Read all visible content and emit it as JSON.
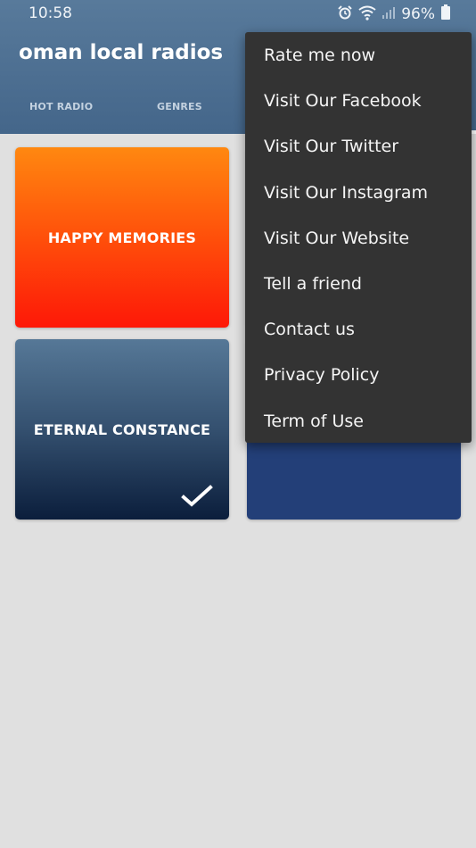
{
  "status_bar": {
    "time": "10:58",
    "battery_percent": "96%",
    "icons": [
      "alarm-icon",
      "wifi-icon",
      "signal-icon",
      "battery-icon"
    ]
  },
  "app": {
    "title": "oman local radios"
  },
  "tabs": [
    {
      "label": "HOT RADIO"
    },
    {
      "label": "GENRES"
    }
  ],
  "cards": [
    {
      "label": "HAPPY MEMORIES"
    },
    {
      "label": "ETERNAL CONSTANCE",
      "selected": true
    }
  ],
  "overflow_menu": {
    "items": [
      {
        "label": "Rate me now"
      },
      {
        "label": "Visit Our Facebook"
      },
      {
        "label": "Visit Our Twitter"
      },
      {
        "label": "Visit Our Instagram"
      },
      {
        "label": "Visit Our Website"
      },
      {
        "label": "Tell a friend"
      },
      {
        "label": "Contact us"
      },
      {
        "label": "Privacy Policy"
      },
      {
        "label": "Term of Use"
      }
    ]
  },
  "colors": {
    "app_bar": "#4f7194",
    "menu_background": "#333333",
    "page_background": "#e0e0e0"
  }
}
